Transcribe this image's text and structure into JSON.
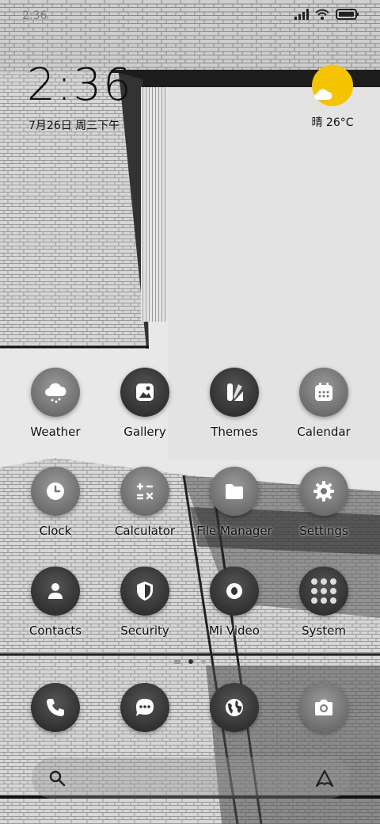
{
  "status": {
    "time": "2:36"
  },
  "lockclock": {
    "time": "2:36",
    "date": "7月26日 周三下午"
  },
  "weather_widget": {
    "text": "晴 26°C"
  },
  "apps": [
    {
      "label": "Weather",
      "icon": "weather-icon"
    },
    {
      "label": "Gallery",
      "icon": "gallery-icon"
    },
    {
      "label": "Themes",
      "icon": "themes-icon"
    },
    {
      "label": "Calendar",
      "icon": "calendar-icon"
    },
    {
      "label": "Clock",
      "icon": "clock-icon"
    },
    {
      "label": "Calculator",
      "icon": "calculator-icon"
    },
    {
      "label": "File Manager",
      "icon": "folder-icon"
    },
    {
      "label": "Settings",
      "icon": "gear-icon"
    },
    {
      "label": "Contacts",
      "icon": "contacts-icon"
    },
    {
      "label": "Security",
      "icon": "shield-icon"
    },
    {
      "label": "Mi Video",
      "icon": "video-icon"
    },
    {
      "label": "System",
      "icon": "folder-grid-icon"
    }
  ],
  "dock": [
    {
      "icon": "phone-icon"
    },
    {
      "icon": "message-icon"
    },
    {
      "icon": "browser-icon"
    },
    {
      "icon": "camera-icon"
    }
  ],
  "colors": {
    "sun": "#f5c400",
    "label": "#111111"
  }
}
